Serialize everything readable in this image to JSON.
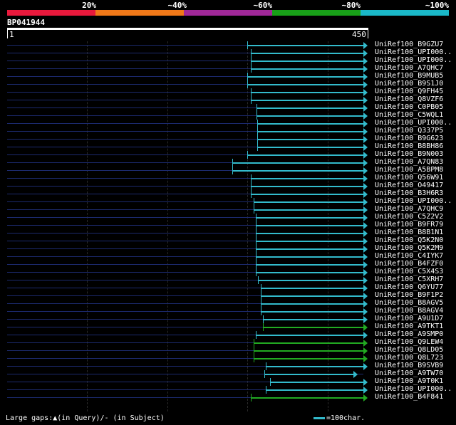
{
  "legend": {
    "labels": [
      "20%",
      "~40%",
      "~60%",
      "~80%",
      "~100%"
    ],
    "colors": [
      "#e8193c",
      "#f07818",
      "#a02898",
      "#18a018",
      "#1ab8c8"
    ]
  },
  "query": {
    "id": "BP041944",
    "start_label": "1",
    "end_label": "450",
    "length": 450
  },
  "colors": {
    "cyan": "#33bbcc",
    "green": "#22aa22",
    "baseline": "#1c2a6e"
  },
  "hits": [
    {
      "name": "UniRef100_B9GZU7",
      "start": 303,
      "end": 450,
      "color": "cyan"
    },
    {
      "name": "UniRef100_UPI000..",
      "start": 308,
      "end": 450,
      "color": "cyan"
    },
    {
      "name": "UniRef100_UPI000..",
      "start": 308,
      "end": 450,
      "color": "cyan"
    },
    {
      "name": "UniRef100_A7QHC7",
      "start": 308,
      "end": 450,
      "color": "cyan"
    },
    {
      "name": "UniRef100_B9MUB5",
      "start": 303,
      "end": 450,
      "color": "cyan"
    },
    {
      "name": "UniRef100_B9S1J0",
      "start": 303,
      "end": 450,
      "color": "cyan"
    },
    {
      "name": "UniRef100_Q9FH45",
      "start": 308,
      "end": 450,
      "color": "cyan"
    },
    {
      "name": "UniRef100_Q8VZF6",
      "start": 308,
      "end": 450,
      "color": "cyan"
    },
    {
      "name": "UniRef100_C0PB05",
      "start": 315,
      "end": 450,
      "color": "cyan"
    },
    {
      "name": "UniRef100_C5WQL1",
      "start": 315,
      "end": 450,
      "color": "cyan"
    },
    {
      "name": "UniRef100_UPI000..",
      "start": 316,
      "end": 450,
      "color": "cyan"
    },
    {
      "name": "UniRef100_Q337P5",
      "start": 316,
      "end": 450,
      "color": "cyan"
    },
    {
      "name": "UniRef100_B9G623",
      "start": 316,
      "end": 450,
      "color": "cyan"
    },
    {
      "name": "UniRef100_B8BH86",
      "start": 316,
      "end": 450,
      "color": "cyan"
    },
    {
      "name": "UniRef100_B9N003",
      "start": 303,
      "end": 450,
      "color": "cyan"
    },
    {
      "name": "UniRef100_A7QN83",
      "start": 284,
      "end": 450,
      "color": "cyan"
    },
    {
      "name": "UniRef100_A5BPM8",
      "start": 284,
      "end": 450,
      "color": "cyan"
    },
    {
      "name": "UniRef100_Q56W91",
      "start": 308,
      "end": 450,
      "color": "cyan"
    },
    {
      "name": "UniRef100_O49417",
      "start": 308,
      "end": 450,
      "color": "cyan"
    },
    {
      "name": "UniRef100_B3H6R3",
      "start": 308,
      "end": 450,
      "color": "cyan"
    },
    {
      "name": "UniRef100_UPI000..",
      "start": 311,
      "end": 450,
      "color": "cyan"
    },
    {
      "name": "UniRef100_A7QHC9",
      "start": 311,
      "end": 450,
      "color": "cyan"
    },
    {
      "name": "UniRef100_C5Z2V2",
      "start": 314,
      "end": 450,
      "color": "cyan"
    },
    {
      "name": "UniRef100_B9FR79",
      "start": 314,
      "end": 450,
      "color": "cyan"
    },
    {
      "name": "UniRef100_B8B1N1",
      "start": 314,
      "end": 450,
      "color": "cyan"
    },
    {
      "name": "UniRef100_Q5K2N0",
      "start": 314,
      "end": 450,
      "color": "cyan"
    },
    {
      "name": "UniRef100_Q5K2M9",
      "start": 314,
      "end": 450,
      "color": "cyan"
    },
    {
      "name": "UniRef100_C4IYK7",
      "start": 314,
      "end": 450,
      "color": "cyan"
    },
    {
      "name": "UniRef100_B4FZF0",
      "start": 314,
      "end": 450,
      "color": "cyan"
    },
    {
      "name": "UniRef100_C5X4S3",
      "start": 314,
      "end": 450,
      "color": "cyan"
    },
    {
      "name": "UniRef100_C5XRH7",
      "start": 317,
      "end": 450,
      "color": "cyan"
    },
    {
      "name": "UniRef100_Q6YU77",
      "start": 320,
      "end": 450,
      "color": "cyan"
    },
    {
      "name": "UniRef100_B9F1P2",
      "start": 320,
      "end": 450,
      "color": "cyan"
    },
    {
      "name": "UniRef100_B8AGV5",
      "start": 320,
      "end": 450,
      "color": "cyan"
    },
    {
      "name": "UniRef100_B8AGV4",
      "start": 320,
      "end": 450,
      "color": "cyan"
    },
    {
      "name": "UniRef100_A9U1D7",
      "start": 323,
      "end": 450,
      "color": "cyan"
    },
    {
      "name": "UniRef100_A9TKT1",
      "start": 323,
      "end": 450,
      "color": "green"
    },
    {
      "name": "UniRef100_A9SMP0",
      "start": 314,
      "end": 450,
      "color": "cyan"
    },
    {
      "name": "UniRef100_Q9LEW4",
      "start": 311,
      "end": 450,
      "color": "green"
    },
    {
      "name": "UniRef100_Q8LD05",
      "start": 311,
      "end": 450,
      "color": "green"
    },
    {
      "name": "UniRef100_Q8L723",
      "start": 311,
      "end": 450,
      "color": "green"
    },
    {
      "name": "UniRef100_B9SVB9",
      "start": 327,
      "end": 450,
      "color": "cyan"
    },
    {
      "name": "UniRef100_A9TW70",
      "start": 325,
      "end": 437,
      "color": "cyan"
    },
    {
      "name": "UniRef100_A9T0K1",
      "start": 332,
      "end": 450,
      "color": "cyan"
    },
    {
      "name": "UniRef100_UPI000..",
      "start": 327,
      "end": 450,
      "color": "cyan"
    },
    {
      "name": "UniRef100_B4F841",
      "start": 308,
      "end": 450,
      "color": "green"
    }
  ],
  "footer": {
    "gaps_text": "Large gaps:▲(in Query)/- (in Subject)",
    "scale_text": "=100char."
  }
}
